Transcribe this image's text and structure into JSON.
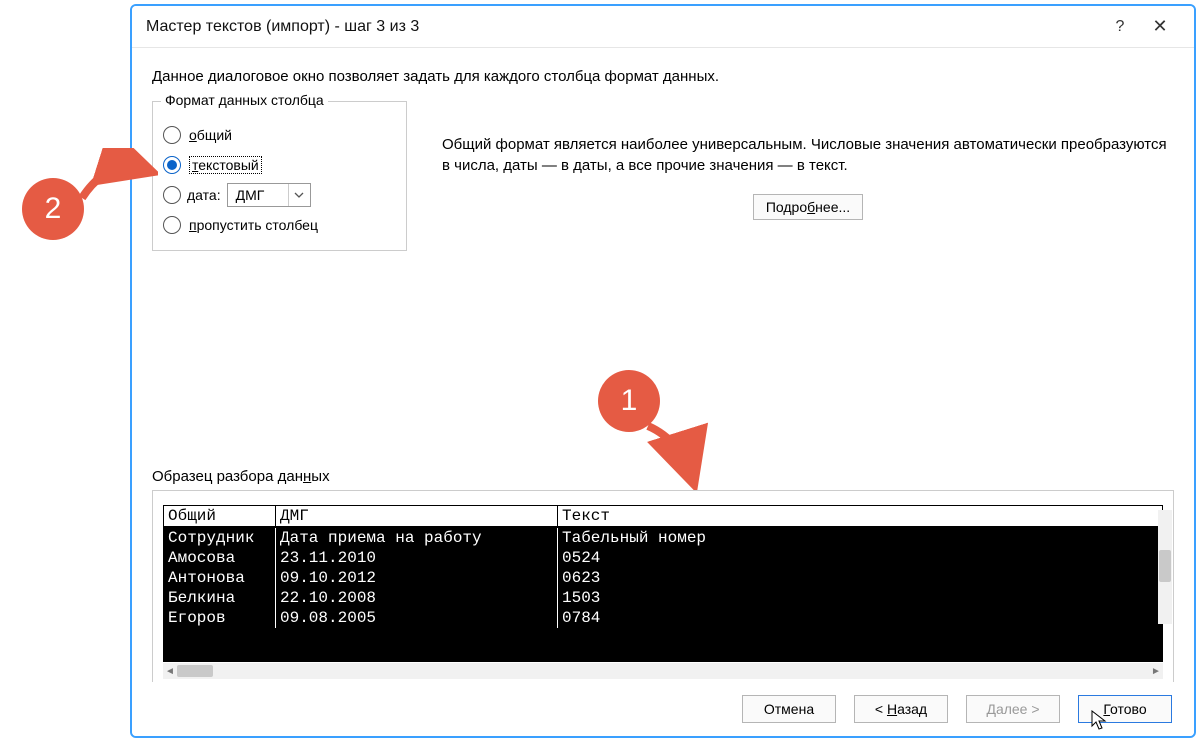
{
  "title": "Мастер текстов (импорт) - шаг 3 из 3",
  "description": "Данное диалоговое окно позволяет задать для каждого столбца формат данных.",
  "format_group": {
    "legend": "Формат данных столбца",
    "options": {
      "general": "общий",
      "text": "текстовый",
      "date": "дата:",
      "skip": "пропустить столбец"
    },
    "date_value": "ДМГ"
  },
  "explain": "Общий формат является наиболее универсальным. Числовые значения автоматически преобразуются в числа, даты — в даты, а все прочие значения — в текст.",
  "more_btn": "Подробнее...",
  "preview_legend": "Образец разбора данных",
  "preview": {
    "headers": [
      "Общий",
      "ДМГ",
      "Текст"
    ],
    "rows": [
      [
        "Сотрудник",
        "Дата приема на работу",
        "Табельный номер"
      ],
      [
        "Амосова",
        "23.11.2010",
        "0524"
      ],
      [
        "Антонова",
        "09.10.2012",
        "0623"
      ],
      [
        "Белкина",
        "22.10.2008",
        "1503"
      ],
      [
        "Егоров",
        "09.08.2005",
        "0784"
      ]
    ]
  },
  "buttons": {
    "cancel": "Отмена",
    "back": "< Назад",
    "next": "Далее >",
    "finish": "Готово"
  },
  "callouts": {
    "one": "1",
    "two": "2"
  }
}
